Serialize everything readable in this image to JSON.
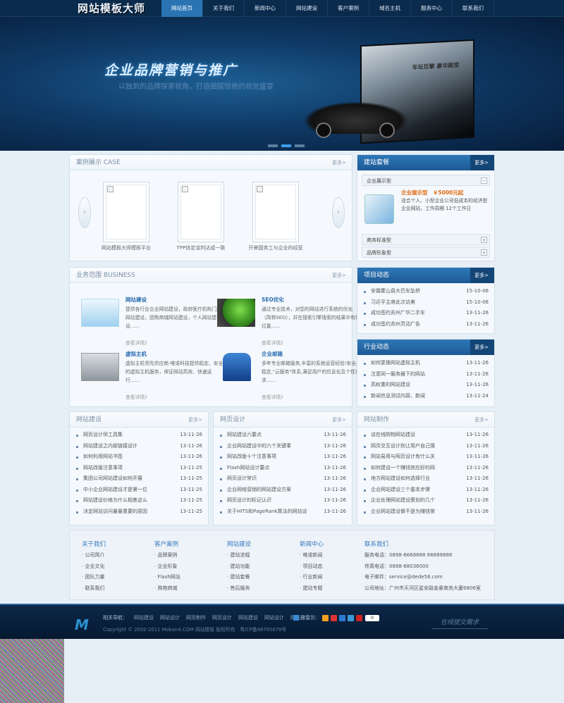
{
  "header": {
    "logo": "网站模板大师",
    "nav": [
      "网站首页",
      "关于我们",
      "新闻中心",
      "网站建设",
      "客户案例",
      "域名主机",
      "服务中心",
      "联系我们"
    ]
  },
  "banner": {
    "title": "企业品牌营销与推广",
    "subtitle": "以独到的品牌探索视角，打造细腻惊艳的视觉盛宴",
    "showroom_caption": "车坛巨擘 豪华殿堂"
  },
  "case": {
    "title": "案例展示 CASE",
    "more": "更多>",
    "items": [
      "网站模板大师模板平台",
      "TPP协定谈判达成一致",
      "开美国务工与企业的经营"
    ]
  },
  "combo": {
    "title": "建站套餐",
    "more": "更多>",
    "rows": [
      "企业展示型",
      "商务标准型",
      "品牌形象型"
    ],
    "product_name": "企业展示型",
    "price": "￥5000元起",
    "desc": "适合个人、小型企业公司低成本的经济型企业网站，工作周期 12个工作日"
  },
  "business": {
    "title": "业务范围 BUSINESS",
    "more": "更多>",
    "items": [
      {
        "title": "网站建设",
        "desc": "提供各行业企业网站建设，政府医疗机构门户网站建设，团购商城网站建设，个人网站建设......",
        "more": "查看详情》"
      },
      {
        "title": "SEO优化",
        "desc": "通过专业技术，对您的网站进行系统的优化（简称SEO），并在搜索引擎搜索的结果中有利位置......",
        "more": "查看详情》"
      },
      {
        "title": "虚拟主机",
        "desc": "虚拟主机领先供应商-唯诺科技提供稳定、安全的虚拟主机服务，保证网站高效、快速运行......",
        "more": "查看详情》"
      },
      {
        "title": "企业邮箱",
        "desc": "多年专业邮箱服务,丰富的系统运营经验!安全,稳定,\"云服务\"体系,满足用户的信息化及个性需求......",
        "more": "查看详情》"
      }
    ]
  },
  "project_news": {
    "title": "项目动态",
    "more": "更多>",
    "items": [
      {
        "t": "安徽霍山县大巴车坠桥",
        "d": "15-10-06"
      },
      {
        "t": "习近平主席此次访美",
        "d": "15-10-06"
      },
      {
        "t": "成功签约苏州广华二手车",
        "d": "13-11-26"
      },
      {
        "t": "成功签约苏州灵动广告",
        "d": "13-11-26"
      }
    ]
  },
  "industry_news": {
    "title": "行业动态",
    "more": "更多>",
    "items": [
      {
        "t": "如何更换网站虚拟主机",
        "d": "13-11-26"
      },
      {
        "t": "注意同一服务器下的网站",
        "d": "13-11-26"
      },
      {
        "t": "高权重的网站建设",
        "d": "13-11-26"
      },
      {
        "t": "新闻信息测试内容、新闻",
        "d": "13-11-24"
      }
    ]
  },
  "col_build": {
    "title": "网站建设",
    "more": "更多>",
    "items": [
      {
        "t": "网页设计师工具集",
        "d": "13-11-26"
      },
      {
        "t": "网站建设之内部链接设计",
        "d": "13-11-26"
      },
      {
        "t": "如何利用网站书签",
        "d": "13-11-26"
      },
      {
        "t": "网站改版注意事项",
        "d": "13-11-25"
      },
      {
        "t": "集团公司网站建设如何开展",
        "d": "13-11-25"
      },
      {
        "t": "中小企业网站建设才是第一位",
        "d": "13-11-25"
      },
      {
        "t": "网站建设价格为什么相差这么",
        "d": "13-11-25"
      },
      {
        "t": "决定网站访问量最重要的原因",
        "d": "13-11-25"
      }
    ]
  },
  "col_design": {
    "title": "网页设计",
    "more": "更多>",
    "items": [
      {
        "t": "网站建设六要点",
        "d": "13-11-26"
      },
      {
        "t": "企业网站建设中的六个关键事",
        "d": "13-11-26"
      },
      {
        "t": "网站改版十个注意事项",
        "d": "13-11-26"
      },
      {
        "t": "Flash网站设计要点",
        "d": "13-11-26"
      },
      {
        "t": "网页设计常识",
        "d": "13-11-26"
      },
      {
        "t": "企业网络营销的网站建设方案",
        "d": "13-11-26"
      },
      {
        "t": "网页设计的标记认识",
        "d": "13-11-26"
      },
      {
        "t": "关于HITS和PageRank算法的网站设",
        "d": "13-11-26"
      }
    ]
  },
  "col_make": {
    "title": "网站制作",
    "more": "更多>",
    "items": [
      {
        "t": "谈在线购物网站建设",
        "d": "13-11-26"
      },
      {
        "t": "网页交互设计别让用户自己猜",
        "d": "13-11-26"
      },
      {
        "t": "网站易用与网页设计有什么关",
        "d": "13-11-26"
      },
      {
        "t": "如何建设一个赚钱效应好的网",
        "d": "13-11-26"
      },
      {
        "t": "地方网站建设如何选择行业",
        "d": "13-11-26"
      },
      {
        "t": "企业网站建设三个基本步骤",
        "d": "13-11-26"
      },
      {
        "t": "企业处理网站建设策划的几个",
        "d": "13-11-26"
      },
      {
        "t": "企业网站建设做不是为赚钱誉",
        "d": "13-11-26"
      }
    ]
  },
  "footer_links": {
    "cols": [
      {
        "h": "关于我们",
        "items": [
          "公司简介",
          "企业文化",
          "团队力量",
          "联系我们"
        ]
      },
      {
        "h": "客户案例",
        "items": [
          "品牌案例",
          "企业形象",
          "Flash网站",
          "购物商城"
        ]
      },
      {
        "h": "网站建设",
        "items": [
          "建站流程",
          "建站功能",
          "建站套餐",
          "售后服务"
        ]
      },
      {
        "h": "新闻中心",
        "items": [
          "唯诺新闻",
          "项目动态",
          "行业新闻",
          "建站专题"
        ]
      }
    ],
    "contact": {
      "h": "联系我们",
      "lines": [
        "服务电话：0898-6668888 66889888",
        "传真电话：0898-68036000",
        "电子邮件：service@dede58.com",
        "公司地址：广州市天河区星安路金豪商务大厦6806室"
      ]
    }
  },
  "footbar": {
    "logo": "M",
    "links_label": "相关导航：",
    "links": [
      "网站建设",
      "网站设计",
      "网页制作",
      "网页设计",
      "网站建设",
      "网站设计",
      "网站建设"
    ],
    "copyright": "Copyright © 2002-2011 Moban4.COM 网站模板 版权所有　粤ICP备98765678号",
    "share_label": "分享到：",
    "share_count": "0",
    "online": "在线提交需求"
  }
}
